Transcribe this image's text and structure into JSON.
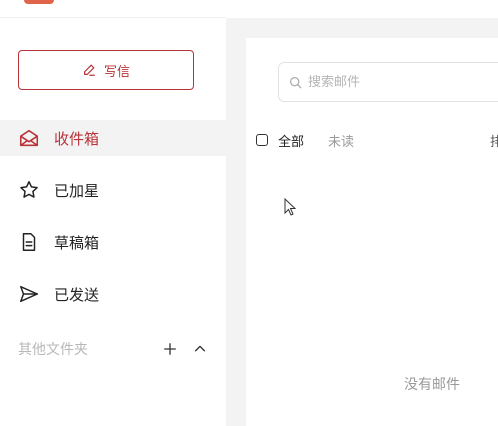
{
  "sidebar": {
    "compose_label": "写信",
    "items": [
      {
        "key": "inbox",
        "label": "收件箱",
        "icon": "envelope-open-icon",
        "active": true
      },
      {
        "key": "starred",
        "label": "已加星",
        "icon": "star-icon",
        "active": false
      },
      {
        "key": "drafts",
        "label": "草稿箱",
        "icon": "document-icon",
        "active": false
      },
      {
        "key": "sent",
        "label": "已发送",
        "icon": "send-icon",
        "active": false
      }
    ],
    "other_folders_label": "其他文件夹"
  },
  "main": {
    "search_placeholder": "搜索邮件",
    "filter_all": "全部",
    "filter_unread": "未读",
    "filter_more": "排",
    "empty_text": "没有邮件"
  },
  "colors": {
    "accent": "#b8343a",
    "logo": "#e0644a",
    "muted_text": "#999999"
  }
}
